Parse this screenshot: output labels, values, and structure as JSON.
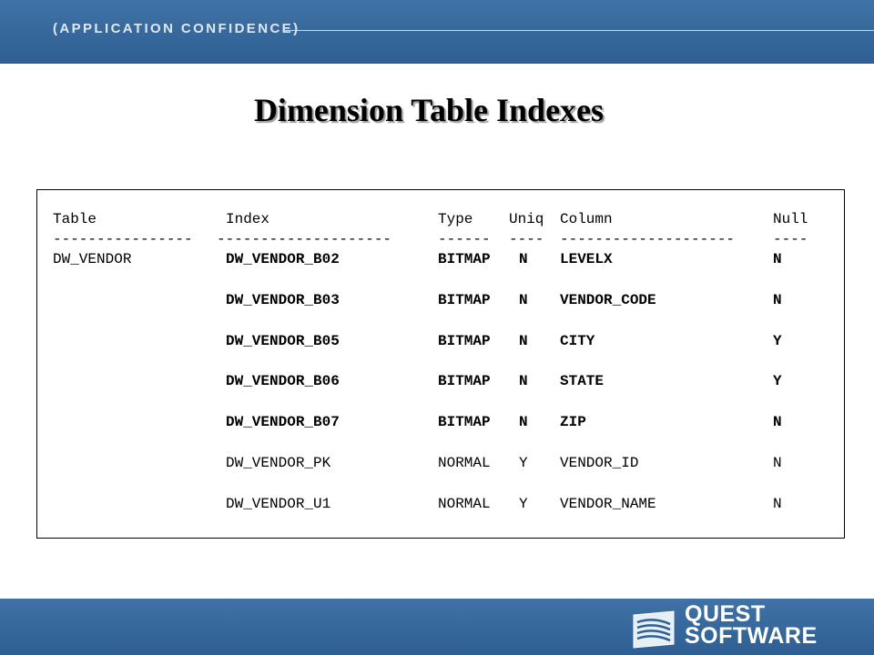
{
  "header": {
    "tagline": "(APPLICATION CONFIDENCE)"
  },
  "title": "Dimension Table Indexes",
  "listing": {
    "columns": [
      "Table",
      "Index",
      "Type",
      "Uniq",
      "Column",
      "Null"
    ],
    "separators": [
      "----------------",
      "--------------------",
      "------",
      "----",
      "--------------------",
      "----"
    ],
    "rows": [
      {
        "table": "DW_VENDOR",
        "index": "DW_VENDOR_B02",
        "type": "BITMAP",
        "uniq": "N",
        "column": "LEVELX",
        "null": "N",
        "emphasis": true
      },
      {
        "table": "",
        "index": "DW_VENDOR_B03",
        "type": "BITMAP",
        "uniq": "N",
        "column": "VENDOR_CODE",
        "null": "N",
        "emphasis": true
      },
      {
        "table": "",
        "index": "DW_VENDOR_B05",
        "type": "BITMAP",
        "uniq": "N",
        "column": "CITY",
        "null": "Y",
        "emphasis": true
      },
      {
        "table": "",
        "index": "DW_VENDOR_B06",
        "type": "BITMAP",
        "uniq": "N",
        "column": "STATE",
        "null": "Y",
        "emphasis": true
      },
      {
        "table": "",
        "index": "DW_VENDOR_B07",
        "type": "BITMAP",
        "uniq": "N",
        "column": "ZIP",
        "null": "N",
        "emphasis": true
      },
      {
        "table": "",
        "index": "DW_VENDOR_PK",
        "type": "NORMAL",
        "uniq": "Y",
        "column": "VENDOR_ID",
        "null": "N",
        "emphasis": false
      },
      {
        "table": "",
        "index": "DW_VENDOR_U1",
        "type": "NORMAL",
        "uniq": "Y",
        "column": "VENDOR_NAME",
        "null": "N",
        "emphasis": false
      }
    ]
  },
  "footer": {
    "logo": {
      "line1": "QUEST",
      "line2": "SOFTWARE",
      "icon": "quest-logo-icon"
    }
  },
  "colors": {
    "banner": "#3a6b9e",
    "tagline": "#dfe8f2",
    "title_shadow": "#9a9a9a"
  }
}
